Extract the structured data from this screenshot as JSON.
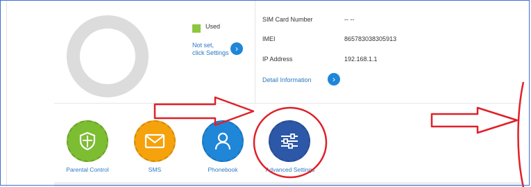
{
  "usage": {
    "legend_label": "Used",
    "not_set_line1": "Not set,",
    "not_set_line2": "click Settings"
  },
  "device_info": {
    "sim_label": "SIM Card Number",
    "sim_value": "-- --",
    "imei_label": "IMEI",
    "imei_value": "865783038305913",
    "ip_label": "IP Address",
    "ip_value": "192.168.1.1",
    "detail_link": "Detail Information"
  },
  "apps": [
    {
      "label": "Parental Control",
      "color": "#7cbd32",
      "icon": "shield-icon"
    },
    {
      "label": "SMS",
      "color": "#f5a20c",
      "icon": "envelope-icon"
    },
    {
      "label": "Phonebook",
      "color": "#1f86d8",
      "icon": "contact-icon"
    },
    {
      "label": "Advanced Settings",
      "color": "#2d58a8",
      "icon": "sliders-icon"
    }
  ],
  "annotation_color": "#e0202a"
}
